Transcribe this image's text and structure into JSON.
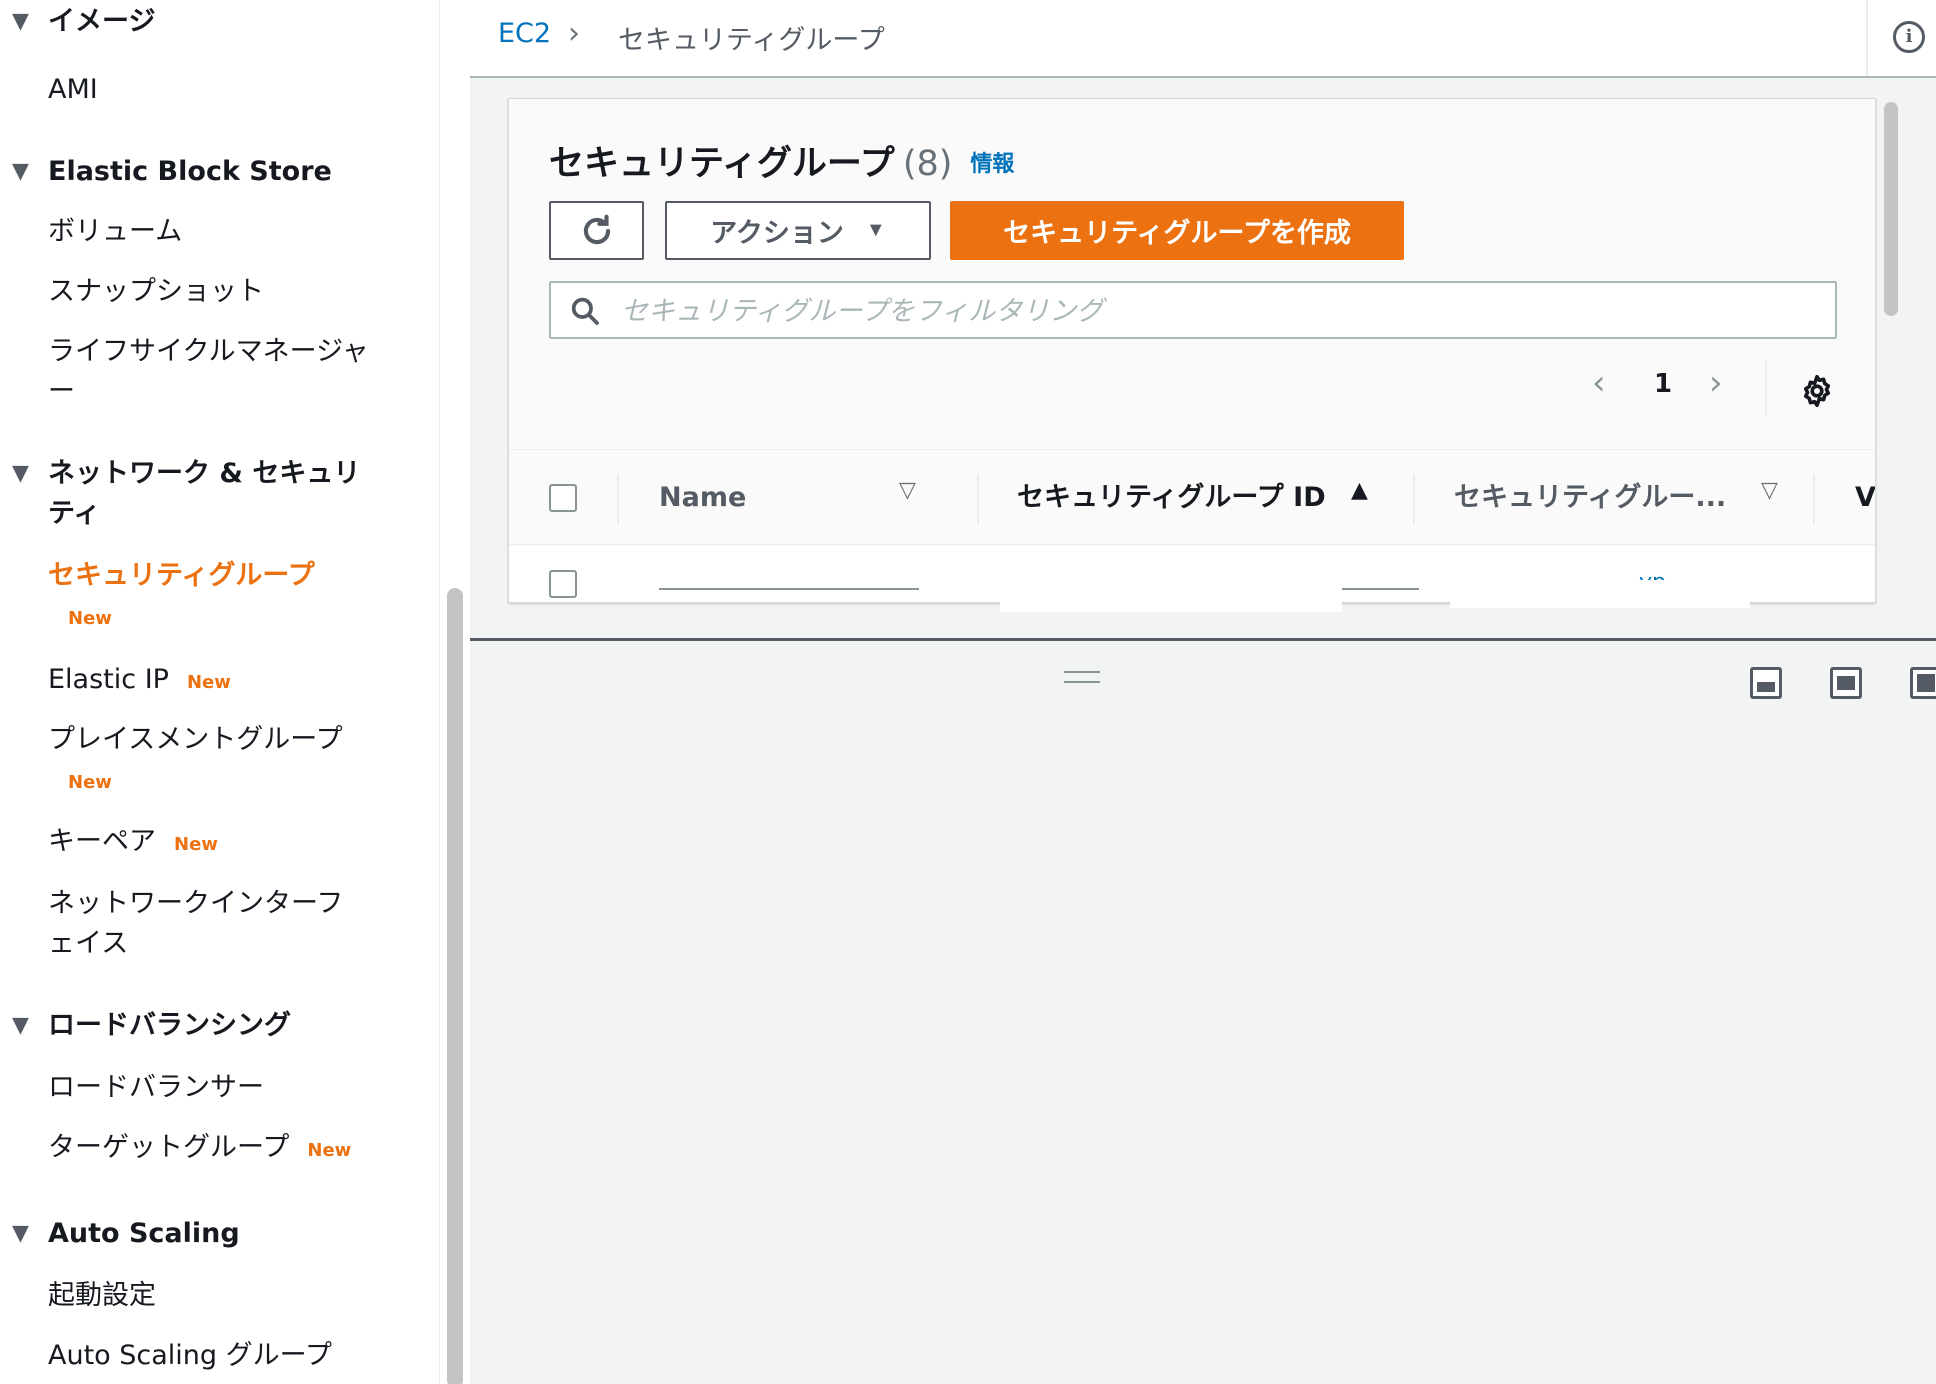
{
  "sidebar": {
    "sections": [
      {
        "title": "イメージ",
        "items": [
          {
            "label": "AMI"
          }
        ]
      },
      {
        "title": "Elastic Block Store",
        "items": [
          {
            "label": "ボリューム"
          },
          {
            "label": "スナップショット"
          },
          {
            "label": "ライフサイクルマネージャー"
          }
        ]
      },
      {
        "title": "ネットワーク & セキュリティ",
        "items": [
          {
            "label": "セキュリティグループ",
            "badge": "New"
          },
          {
            "label": "Elastic IP",
            "badge": "New"
          },
          {
            "label": "プレイスメントグループ",
            "badge": "New"
          },
          {
            "label": "キーペア",
            "badge": "New"
          },
          {
            "label": "ネットワークインターフェイス"
          }
        ]
      },
      {
        "title": "ロードバランシング",
        "items": [
          {
            "label": "ロードバランサー"
          },
          {
            "label": "ターゲットグループ",
            "badge": "New"
          }
        ]
      },
      {
        "title": "Auto Scaling",
        "items": [
          {
            "label": "起動設定"
          },
          {
            "label": "Auto Scaling グループ"
          }
        ]
      }
    ]
  },
  "breadcrumb": {
    "root": "EC2",
    "separator": "›",
    "current": "セキュリティグループ"
  },
  "panel": {
    "title": "セキュリティグループ",
    "count": "(8)",
    "info_link": "情報",
    "actions_label": "アクション",
    "create_label": "セキュリティグループを作成",
    "search_placeholder": "セキュリティグループをフィルタリング",
    "page": "1"
  },
  "table": {
    "columns": [
      "Name",
      "セキュリティグループ ID",
      "セキュリティグルー...",
      "VI"
    ],
    "rows": [
      {
        "vpc": "vp"
      }
    ]
  },
  "colors": {
    "accent": "#ec7211",
    "link": "#0073bb",
    "text": "#16191f"
  }
}
